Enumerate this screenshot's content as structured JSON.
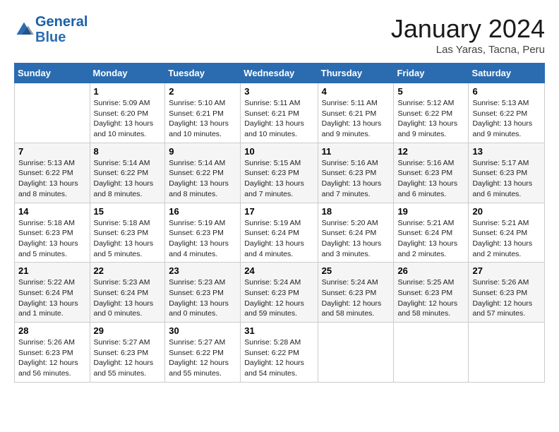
{
  "header": {
    "logo_line1": "General",
    "logo_line2": "Blue",
    "month_title": "January 2024",
    "location": "Las Yaras, Tacna, Peru"
  },
  "days_of_week": [
    "Sunday",
    "Monday",
    "Tuesday",
    "Wednesday",
    "Thursday",
    "Friday",
    "Saturday"
  ],
  "weeks": [
    [
      {
        "num": "",
        "info": ""
      },
      {
        "num": "1",
        "info": "Sunrise: 5:09 AM\nSunset: 6:20 PM\nDaylight: 13 hours\nand 10 minutes."
      },
      {
        "num": "2",
        "info": "Sunrise: 5:10 AM\nSunset: 6:21 PM\nDaylight: 13 hours\nand 10 minutes."
      },
      {
        "num": "3",
        "info": "Sunrise: 5:11 AM\nSunset: 6:21 PM\nDaylight: 13 hours\nand 10 minutes."
      },
      {
        "num": "4",
        "info": "Sunrise: 5:11 AM\nSunset: 6:21 PM\nDaylight: 13 hours\nand 9 minutes."
      },
      {
        "num": "5",
        "info": "Sunrise: 5:12 AM\nSunset: 6:22 PM\nDaylight: 13 hours\nand 9 minutes."
      },
      {
        "num": "6",
        "info": "Sunrise: 5:13 AM\nSunset: 6:22 PM\nDaylight: 13 hours\nand 9 minutes."
      }
    ],
    [
      {
        "num": "7",
        "info": "Sunrise: 5:13 AM\nSunset: 6:22 PM\nDaylight: 13 hours\nand 8 minutes."
      },
      {
        "num": "8",
        "info": "Sunrise: 5:14 AM\nSunset: 6:22 PM\nDaylight: 13 hours\nand 8 minutes."
      },
      {
        "num": "9",
        "info": "Sunrise: 5:14 AM\nSunset: 6:22 PM\nDaylight: 13 hours\nand 8 minutes."
      },
      {
        "num": "10",
        "info": "Sunrise: 5:15 AM\nSunset: 6:23 PM\nDaylight: 13 hours\nand 7 minutes."
      },
      {
        "num": "11",
        "info": "Sunrise: 5:16 AM\nSunset: 6:23 PM\nDaylight: 13 hours\nand 7 minutes."
      },
      {
        "num": "12",
        "info": "Sunrise: 5:16 AM\nSunset: 6:23 PM\nDaylight: 13 hours\nand 6 minutes."
      },
      {
        "num": "13",
        "info": "Sunrise: 5:17 AM\nSunset: 6:23 PM\nDaylight: 13 hours\nand 6 minutes."
      }
    ],
    [
      {
        "num": "14",
        "info": "Sunrise: 5:18 AM\nSunset: 6:23 PM\nDaylight: 13 hours\nand 5 minutes."
      },
      {
        "num": "15",
        "info": "Sunrise: 5:18 AM\nSunset: 6:23 PM\nDaylight: 13 hours\nand 5 minutes."
      },
      {
        "num": "16",
        "info": "Sunrise: 5:19 AM\nSunset: 6:23 PM\nDaylight: 13 hours\nand 4 minutes."
      },
      {
        "num": "17",
        "info": "Sunrise: 5:19 AM\nSunset: 6:24 PM\nDaylight: 13 hours\nand 4 minutes."
      },
      {
        "num": "18",
        "info": "Sunrise: 5:20 AM\nSunset: 6:24 PM\nDaylight: 13 hours\nand 3 minutes."
      },
      {
        "num": "19",
        "info": "Sunrise: 5:21 AM\nSunset: 6:24 PM\nDaylight: 13 hours\nand 2 minutes."
      },
      {
        "num": "20",
        "info": "Sunrise: 5:21 AM\nSunset: 6:24 PM\nDaylight: 13 hours\nand 2 minutes."
      }
    ],
    [
      {
        "num": "21",
        "info": "Sunrise: 5:22 AM\nSunset: 6:24 PM\nDaylight: 13 hours\nand 1 minute."
      },
      {
        "num": "22",
        "info": "Sunrise: 5:23 AM\nSunset: 6:24 PM\nDaylight: 13 hours\nand 0 minutes."
      },
      {
        "num": "23",
        "info": "Sunrise: 5:23 AM\nSunset: 6:23 PM\nDaylight: 13 hours\nand 0 minutes."
      },
      {
        "num": "24",
        "info": "Sunrise: 5:24 AM\nSunset: 6:23 PM\nDaylight: 12 hours\nand 59 minutes."
      },
      {
        "num": "25",
        "info": "Sunrise: 5:24 AM\nSunset: 6:23 PM\nDaylight: 12 hours\nand 58 minutes."
      },
      {
        "num": "26",
        "info": "Sunrise: 5:25 AM\nSunset: 6:23 PM\nDaylight: 12 hours\nand 58 minutes."
      },
      {
        "num": "27",
        "info": "Sunrise: 5:26 AM\nSunset: 6:23 PM\nDaylight: 12 hours\nand 57 minutes."
      }
    ],
    [
      {
        "num": "28",
        "info": "Sunrise: 5:26 AM\nSunset: 6:23 PM\nDaylight: 12 hours\nand 56 minutes."
      },
      {
        "num": "29",
        "info": "Sunrise: 5:27 AM\nSunset: 6:23 PM\nDaylight: 12 hours\nand 55 minutes."
      },
      {
        "num": "30",
        "info": "Sunrise: 5:27 AM\nSunset: 6:22 PM\nDaylight: 12 hours\nand 55 minutes."
      },
      {
        "num": "31",
        "info": "Sunrise: 5:28 AM\nSunset: 6:22 PM\nDaylight: 12 hours\nand 54 minutes."
      },
      {
        "num": "",
        "info": ""
      },
      {
        "num": "",
        "info": ""
      },
      {
        "num": "",
        "info": ""
      }
    ]
  ]
}
